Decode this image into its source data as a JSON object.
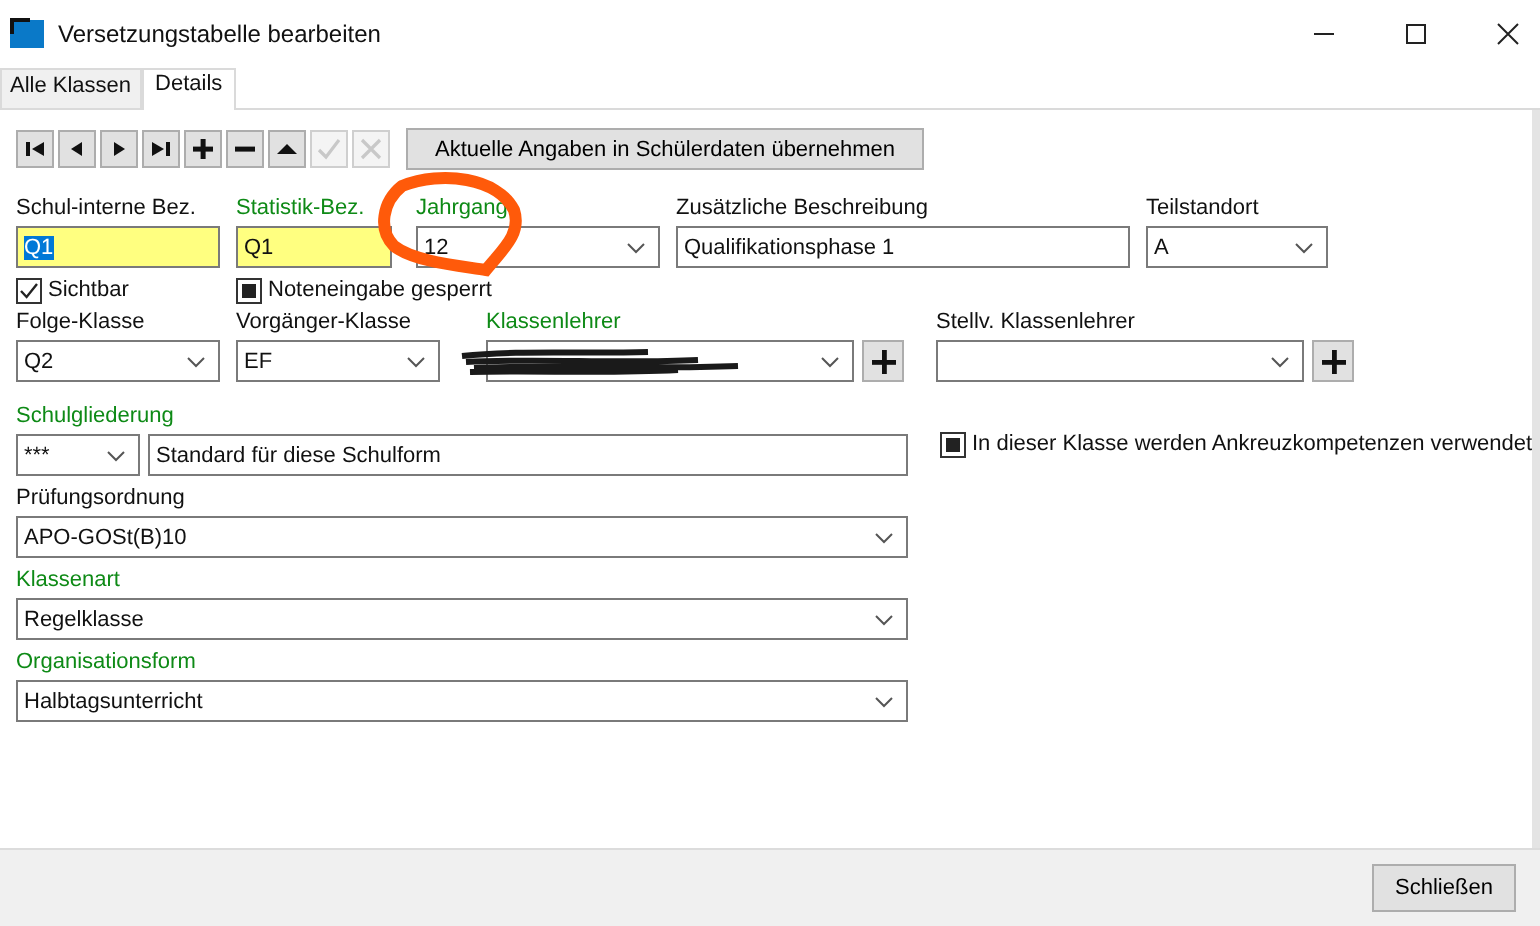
{
  "window": {
    "title": "Versetzungstabelle bearbeiten"
  },
  "tabs": [
    {
      "label": "Alle Klassen",
      "selected": false
    },
    {
      "label": "Details",
      "selected": true
    }
  ],
  "toolbar": {
    "buttons": [
      {
        "kind": "first",
        "disabled": false
      },
      {
        "kind": "prev",
        "disabled": false
      },
      {
        "kind": "next",
        "disabled": false
      },
      {
        "kind": "last",
        "disabled": false
      },
      {
        "kind": "add",
        "disabled": false
      },
      {
        "kind": "remove",
        "disabled": false
      },
      {
        "kind": "up",
        "disabled": false
      },
      {
        "kind": "confirm",
        "disabled": true
      },
      {
        "kind": "cancel",
        "disabled": true
      }
    ],
    "apply_button": "Aktuelle Angaben in Schülerdaten übernehmen"
  },
  "rows": [
    {
      "fields": [
        {
          "kind": "text",
          "label": "Schul-interne Bez.",
          "required": false,
          "value": "Q1",
          "highlighted": true,
          "text_selected": true
        },
        {
          "kind": "text",
          "label": "Statistik-Bez.",
          "required": true,
          "value": "Q1",
          "highlighted": true,
          "text_selected": false
        },
        {
          "kind": "combo",
          "label": "Jahrgang",
          "required": true,
          "value": "12"
        },
        {
          "kind": "text",
          "label": "Zusätzliche Beschreibung",
          "required": false,
          "value": "Qualifikationsphase 1",
          "highlighted": false,
          "text_selected": false
        },
        {
          "kind": "combo",
          "label": "Teilstandort",
          "required": false,
          "value": "A"
        }
      ]
    },
    {
      "fields": [
        {
          "kind": "checkbox",
          "label": "Sichtbar",
          "checked": true
        },
        {
          "kind": "checkbox",
          "label": "Noteneingabe gesperrt",
          "checked": false,
          "grayed": true
        }
      ]
    },
    {
      "fields": [
        {
          "kind": "combo",
          "label": "Folge-Klasse",
          "required": false,
          "value": "Q2"
        },
        {
          "kind": "combo",
          "label": "Vorgänger-Klasse",
          "required": false,
          "value": "EF"
        },
        {
          "kind": "combo_add",
          "label": "Klassenlehrer",
          "required": true,
          "redacted": true
        },
        {
          "kind": "combo_add",
          "label": "Stellv. Klassenlehrer",
          "required": false,
          "redacted": false
        }
      ]
    },
    {
      "fields": [
        {
          "kind": "combo_text",
          "label": "Schulgliederung",
          "required": true,
          "value": "***",
          "description": "Standard für diese Schulform"
        },
        {
          "kind": "checkbox",
          "label": "In dieser Klasse werden Ankreuzkompetenzen verwendet",
          "checked": false,
          "grayed": true
        }
      ]
    },
    {
      "fields": [
        {
          "kind": "combo",
          "label": "Prüfungsordnung",
          "required": false,
          "value": "APO-GOSt(B)10"
        }
      ]
    },
    {
      "fields": [
        {
          "kind": "combo",
          "label": "Klassenart",
          "required": true,
          "value": "Regelklasse"
        }
      ]
    },
    {
      "fields": [
        {
          "kind": "combo",
          "label": "Organisationsform",
          "required": true,
          "value": "Halbtagsunterricht"
        }
      ]
    }
  ],
  "close_button": "Schließen"
}
